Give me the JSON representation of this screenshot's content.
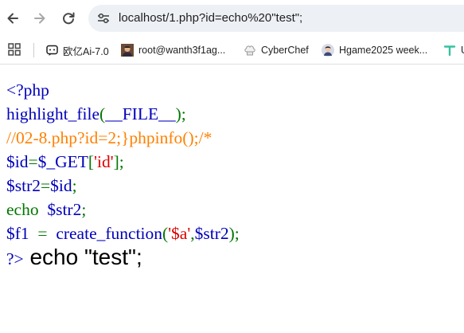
{
  "browser": {
    "url": "localhost/1.php?id=echo%20\"test\";",
    "bookmarks": [
      {
        "label": "欧亿Ai-7.0",
        "icon": "chat-icon"
      },
      {
        "label": "root@wanth3f1ag...",
        "icon": "avatar-photo-icon"
      },
      {
        "label": "CyberChef",
        "icon": "chef-hat-icon"
      },
      {
        "label": "Hgame2025 week...",
        "icon": "avatar-icon"
      },
      {
        "label": "U",
        "icon": "teal-t-icon"
      }
    ]
  },
  "source_lines": [
    [
      {
        "text": "<?php",
        "cls": "c-html"
      }
    ],
    [
      {
        "text": "highlight_file",
        "cls": "c-def"
      },
      {
        "text": "(",
        "cls": "c-kw"
      },
      {
        "text": "__FILE__",
        "cls": "c-def"
      },
      {
        "text": ");",
        "cls": "c-kw"
      }
    ],
    [
      {
        "text": "//02-8.php?id=2;}phpinfo();/*",
        "cls": "c-cmt"
      }
    ],
    [
      {
        "text": "$id",
        "cls": "c-def"
      },
      {
        "text": "=",
        "cls": "c-kw"
      },
      {
        "text": "$_GET",
        "cls": "c-def"
      },
      {
        "text": "[",
        "cls": "c-kw"
      },
      {
        "text": "'id'",
        "cls": "c-str"
      },
      {
        "text": "];",
        "cls": "c-kw"
      }
    ],
    [
      {
        "text": "$str2",
        "cls": "c-def"
      },
      {
        "text": "=",
        "cls": "c-kw"
      },
      {
        "text": "$id",
        "cls": "c-def"
      },
      {
        "text": ";",
        "cls": "c-kw"
      }
    ],
    [
      {
        "text": "echo  ",
        "cls": "c-kw"
      },
      {
        "text": "$str2",
        "cls": "c-def"
      },
      {
        "text": ";",
        "cls": "c-kw"
      }
    ],
    [
      {
        "text": "$f1",
        "cls": "c-def"
      },
      {
        "text": "  =  ",
        "cls": "c-kw"
      },
      {
        "text": "create_function",
        "cls": "c-def"
      },
      {
        "text": "(",
        "cls": "c-kw"
      },
      {
        "text": "'$a'",
        "cls": "c-str"
      },
      {
        "text": ",",
        "cls": "c-kw"
      },
      {
        "text": "$str2",
        "cls": "c-def"
      },
      {
        "text": ");",
        "cls": "c-kw"
      }
    ],
    [
      {
        "text": "?>",
        "cls": "c-html"
      },
      {
        "text": " echo \"test\";",
        "cls": "output"
      }
    ]
  ]
}
